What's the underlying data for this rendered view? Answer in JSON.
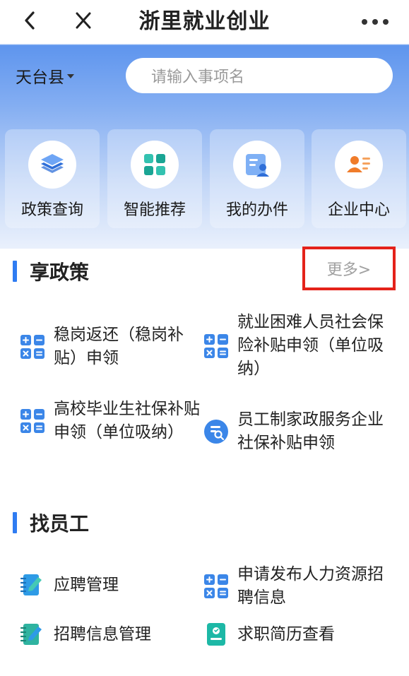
{
  "navbar": {
    "title": "浙里就业创业",
    "back_icon": "chevron-left-icon",
    "close_icon": "close-icon",
    "more_icon": "more-horizontal-icon"
  },
  "header": {
    "region": "天台县",
    "search_placeholder": "请输入事项名"
  },
  "quick_actions": [
    {
      "label": "政策查询",
      "icon": "layers-icon"
    },
    {
      "label": "智能推荐",
      "icon": "grid-icon"
    },
    {
      "label": "我的办件",
      "icon": "id-card-icon"
    },
    {
      "label": "企业中心",
      "icon": "enterprise-user-icon"
    }
  ],
  "policy_section": {
    "title": "享政策",
    "more_label": "更多>",
    "items": [
      {
        "label": "稳岗返还（稳岗补贴）申领",
        "icon": "calculator-icon"
      },
      {
        "label": "就业困难人员社会保险补贴申领（单位吸纳）",
        "icon": "calculator-icon"
      },
      {
        "label": "高校毕业生社保补贴申领（单位吸纳）",
        "icon": "calculator-icon"
      },
      {
        "label": "员工制家政服务企业社保补贴申领",
        "icon": "document-search-icon"
      }
    ]
  },
  "staff_section": {
    "title": "找员工",
    "items": [
      {
        "label": "应聘管理",
        "icon": "notebook-edit-icon"
      },
      {
        "label": "申请发布人力资源招聘信息",
        "icon": "calculator-icon"
      },
      {
        "label": "招聘信息管理",
        "icon": "notebook-edit-icon"
      },
      {
        "label": "求职简历查看",
        "icon": "resume-icon"
      }
    ]
  },
  "colors": {
    "accent": "#2f7cf2",
    "highlight_border": "#e4221a",
    "icon_blue": "#3b86e8",
    "icon_teal": "#1db8a6",
    "icon_orange": "#f07c2a"
  }
}
